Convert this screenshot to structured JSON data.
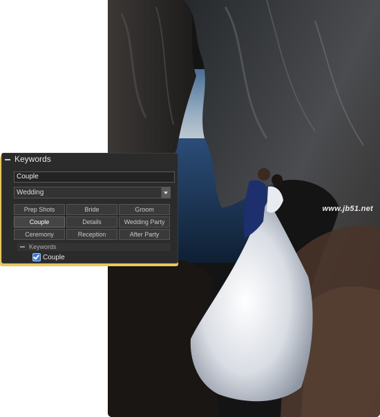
{
  "panel": {
    "title": "Keywords",
    "keyword_input_value": "Couple",
    "keyword_set": "Wedding",
    "keyword_buttons": [
      {
        "label": "Prep Shots",
        "active": false
      },
      {
        "label": "Bride",
        "active": false
      },
      {
        "label": "Groom",
        "active": false
      },
      {
        "label": "Couple",
        "active": true
      },
      {
        "label": "Details",
        "active": false
      },
      {
        "label": "Wedding Party",
        "active": false
      },
      {
        "label": "Ceremony",
        "active": false
      },
      {
        "label": "Reception",
        "active": false
      },
      {
        "label": "After Party",
        "active": false
      }
    ],
    "applied_section_title": "Keywords",
    "applied_keywords": [
      {
        "label": "Couple",
        "checked": true
      }
    ]
  },
  "photo": {
    "watermark": "www.jb51.net"
  },
  "colors": {
    "panel_bg": "#2b2b2b",
    "highlight": "#e7c85a",
    "checkbox": "#3d7ad6"
  }
}
